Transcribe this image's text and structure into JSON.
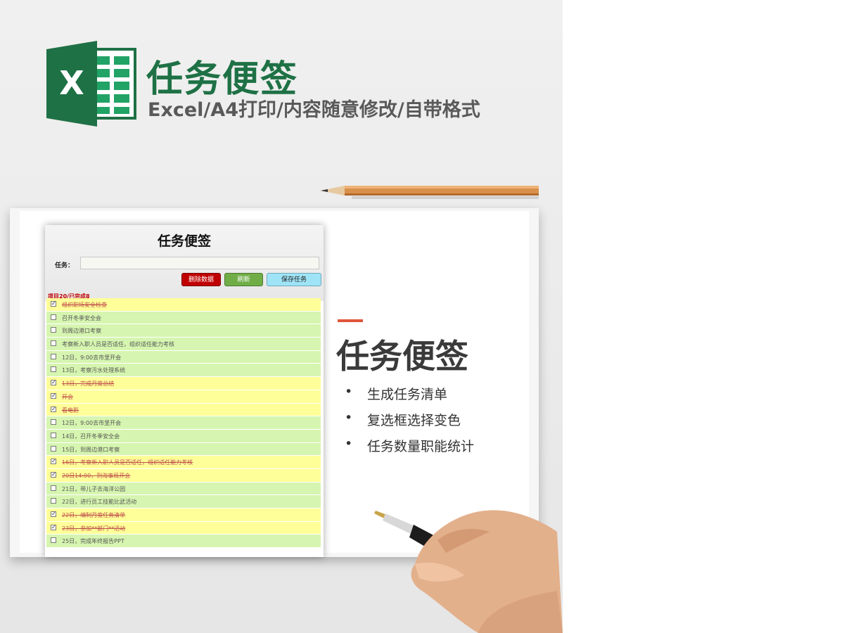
{
  "header": {
    "logo_letter": "X",
    "title": "任务便签",
    "subtitle": "Excel/A4打印/内容随意修改/自带格式"
  },
  "sheet": {
    "title": "任务便签",
    "task_label": "任务：",
    "task_input_value": "",
    "buttons": {
      "delete": "删除数据",
      "refresh": "刷新",
      "save": "保存任务"
    },
    "summary": "项目20/已完成8",
    "tasks": [
      {
        "text": "组织职场安全检查",
        "done": true
      },
      {
        "text": "召开冬季安全会",
        "done": false
      },
      {
        "text": "到周边港口考察",
        "done": false
      },
      {
        "text": "考察新入职人员是否适任，组织适任能力考核",
        "done": false
      },
      {
        "text": "12日，9:00去市里开会",
        "done": false
      },
      {
        "text": "13日，考察污水处理系统",
        "done": false
      },
      {
        "text": "13日，完成月度总结",
        "done": true
      },
      {
        "text": "开会",
        "done": true
      },
      {
        "text": "看电影",
        "done": true
      },
      {
        "text": "12日，9:00去市里开会",
        "done": false
      },
      {
        "text": "14日，召开冬季安全会",
        "done": false
      },
      {
        "text": "15日，到周边港口考察",
        "done": false
      },
      {
        "text": "16日，考察新入职人员是否适任，组织适任能力考核",
        "done": true
      },
      {
        "text": "20日14:00，到海事局开会",
        "done": true
      },
      {
        "text": "21日，带儿子去海洋公园",
        "done": false
      },
      {
        "text": "22日，进行员工技能比武活动",
        "done": false
      },
      {
        "text": "22日，编制月度任务清单",
        "done": true
      },
      {
        "text": "23日，参加**部门**活动",
        "done": true
      },
      {
        "text": "25日，完成年终报告PPT",
        "done": false
      }
    ]
  },
  "promo": {
    "title": "任务便签",
    "bullet_symbol": "•",
    "features": [
      "生成任务清单",
      "复选框选择变色",
      "任务数量职能统计"
    ]
  },
  "colors": {
    "brand_green": "#1e7145",
    "accent": "#e0553a",
    "done_row": "#ffff99",
    "open_row": "#d6f5b0",
    "strike_text": "#c0504d"
  },
  "icons": {
    "logo": "excel-logo-icon",
    "pencil": "pencil-icon",
    "pen": "fountain-pen-icon"
  }
}
